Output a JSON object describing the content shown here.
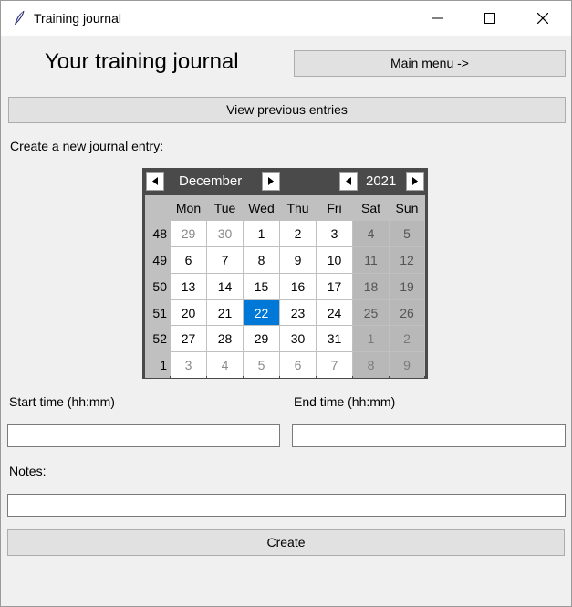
{
  "window": {
    "title": "Training journal"
  },
  "header": {
    "title": "Your training journal",
    "main_menu_label": "Main menu ->"
  },
  "view_previous_label": "View previous entries",
  "create_section_label": "Create a new journal entry:",
  "calendar": {
    "month": "December",
    "year": "2021",
    "weekdays": [
      "Mon",
      "Tue",
      "Wed",
      "Thu",
      "Fri",
      "Sat",
      "Sun"
    ],
    "weeks": [
      {
        "num": "48",
        "days": [
          "29",
          "30",
          "1",
          "2",
          "3",
          "4",
          "5"
        ]
      },
      {
        "num": "49",
        "days": [
          "6",
          "7",
          "8",
          "9",
          "10",
          "11",
          "12"
        ]
      },
      {
        "num": "50",
        "days": [
          "13",
          "14",
          "15",
          "16",
          "17",
          "18",
          "19"
        ]
      },
      {
        "num": "51",
        "days": [
          "20",
          "21",
          "22",
          "23",
          "24",
          "25",
          "26"
        ]
      },
      {
        "num": "52",
        "days": [
          "27",
          "28",
          "29",
          "30",
          "31",
          "1",
          "2"
        ]
      },
      {
        "num": "1",
        "days": [
          "3",
          "4",
          "5",
          "6",
          "7",
          "8",
          "9"
        ]
      }
    ],
    "selected_day": "22",
    "selected_color": "#0078d7"
  },
  "form": {
    "start_label": "Start time (hh:mm)",
    "end_label": "End time (hh:mm)",
    "notes_label": "Notes:",
    "start_value": "",
    "end_value": "",
    "notes_value": ""
  },
  "create_label": "Create"
}
